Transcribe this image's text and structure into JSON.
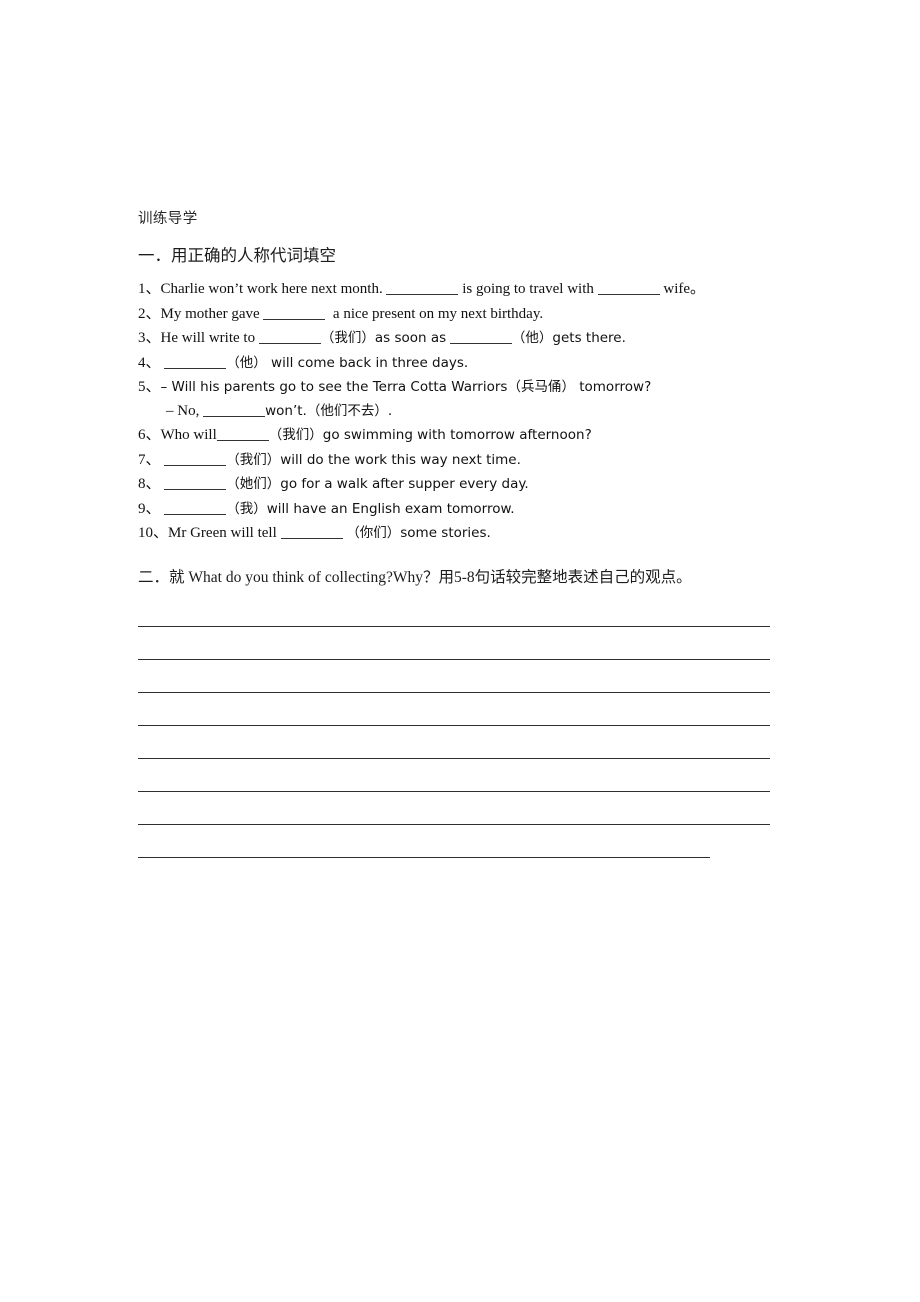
{
  "document": {
    "title": "训练导学",
    "sections": [
      {
        "heading": "一．用正确的人称代词填空",
        "items": [
          {
            "num": "1、",
            "text": "Charlie won’t work here next month.",
            "tail_a": "is going to travel with",
            "tail_b": "wife。"
          },
          {
            "num": "2、",
            "text": "My mother gave",
            "tail_a": "a nice present on my next birthday."
          },
          {
            "num": "3、",
            "text": "He will write    to",
            "mid_cn": "（我们）as soon as",
            "tail_cn": "（他）gets there."
          },
          {
            "num": "4、",
            "lead_blank": true,
            "tail_cn": "（他）  will come back in three days.",
            "text": ""
          },
          {
            "num": "5、",
            "text": "– Will his parents go to see the Terra Cotta Warriors（兵马俑）  tomorrow?",
            "sub": "– No,",
            "sub_tail": "won’t.（他们不去）."
          },
          {
            "num": "6、",
            "text": "Who will",
            "tail_cn": "（我们）go swimming with tomorrow afternoon?"
          },
          {
            "num": "7、",
            "lead_blank": true,
            "tail_cn": "（我们）will do the work this way next time."
          },
          {
            "num": "8、",
            "lead_blank": true,
            "tail_cn": "（她们）go for a walk after supper every day."
          },
          {
            "num": "9、",
            "lead_blank": true,
            "tail_cn": "（我）will have an English exam tomorrow."
          },
          {
            "num": "10、",
            "text": "Mr Green will tell",
            "tail_cn": "（你们）some stories."
          }
        ]
      },
      {
        "heading": "二．就 What do you think of collecting?Why？用5-8句话较完整地表述自己的观点。",
        "answer_line_count": 8,
        "answer_lines": [
          {
            "length": "full"
          },
          {
            "length": "full"
          },
          {
            "length": "full"
          },
          {
            "length": "full"
          },
          {
            "length": "full"
          },
          {
            "length": "full"
          },
          {
            "length": "full"
          },
          {
            "length": "short"
          }
        ]
      }
    ]
  },
  "colors": {
    "page_background": "#ffffff",
    "text": "#111111",
    "rule_line": "#2f2f2f"
  }
}
